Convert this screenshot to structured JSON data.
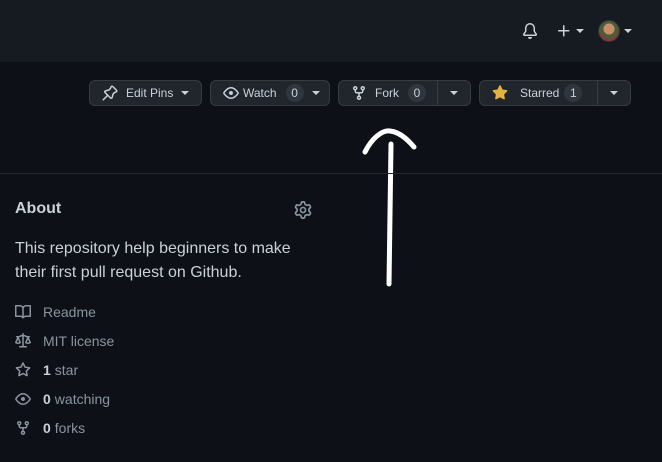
{
  "header": {
    "icons": [
      "bell-icon",
      "plus-icon",
      "avatar"
    ]
  },
  "actions": {
    "edit_pins": {
      "label": "Edit Pins",
      "icon": "pin-icon"
    },
    "watch": {
      "label": "Watch",
      "count": "0",
      "icon": "eye-icon"
    },
    "fork": {
      "label": "Fork",
      "count": "0",
      "icon": "repo-forked-icon"
    },
    "star": {
      "label": "Starred",
      "count": "1",
      "icon": "star-filled-icon",
      "icon_color": "#e3b341"
    }
  },
  "about": {
    "title": "About",
    "description": "This repository help beginners to make their first pull request on Github.",
    "items": [
      {
        "icon": "book-icon",
        "value": "",
        "label": "Readme"
      },
      {
        "icon": "law-icon",
        "value": "",
        "label": "MIT license"
      },
      {
        "icon": "star-icon",
        "value": "1",
        "label": "star"
      },
      {
        "icon": "eye-icon",
        "value": "0",
        "label": "watching"
      },
      {
        "icon": "repo-forked-icon",
        "value": "0",
        "label": "forks"
      }
    ]
  },
  "colors": {
    "background": "#0d1117",
    "header_bg": "#161b22",
    "button_bg": "#21262d",
    "text": "#c9d1d9",
    "muted": "#8b949e",
    "annotation": "#ffffff"
  }
}
